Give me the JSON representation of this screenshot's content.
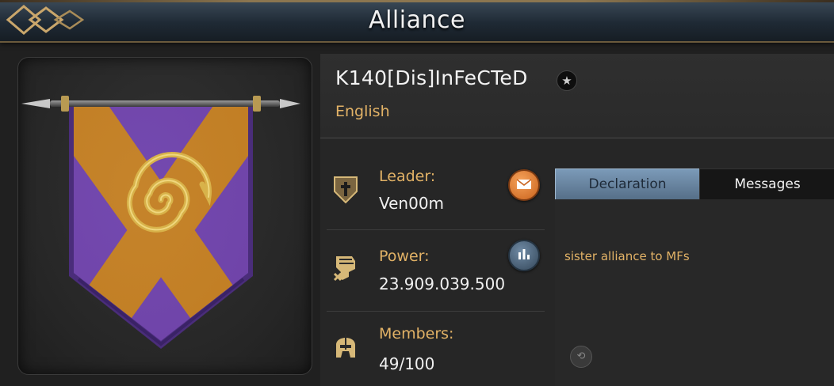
{
  "title": "Alliance",
  "alliance": {
    "name": "K140[Dis]InFeCTeD",
    "language": "English"
  },
  "info": {
    "leader_label": "Leader:",
    "leader_value": "Ven00m",
    "power_label": "Power:",
    "power_value": "23.909.039.500",
    "members_label": "Members:",
    "members_value": "49/100"
  },
  "tabs": {
    "declaration": "Declaration",
    "messages": "Messages",
    "active": "Declaration"
  },
  "declaration_text": "sister alliance to MFs",
  "icons": {
    "back": "ornament-back-icon",
    "star": "star-icon",
    "leader": "crest-shield-icon",
    "power": "fist-icon",
    "members": "helmet-icon",
    "mail": "mail-icon",
    "stats": "bar-chart-icon",
    "translate": "translate-icon"
  },
  "colors": {
    "accent_gold": "#e2b266",
    "banner_purple": "#6b3fb0",
    "banner_orange": "#c27d23",
    "tab_active": "#6e8cab"
  }
}
